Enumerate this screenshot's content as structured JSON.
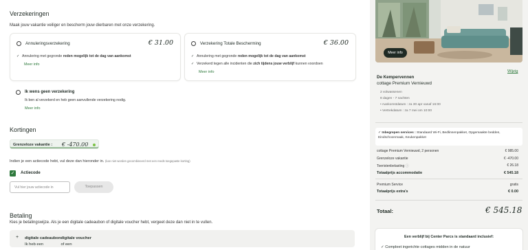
{
  "insurance": {
    "title": "Verzekeringen",
    "subtitle": "Maak jouw vakantie veiliger en bescherm jouw dierbaren met onze verzekering.",
    "options": [
      {
        "name": "Annuleringsverzekering",
        "price": "€ 31.00",
        "feature1_pre": "Annulering met gegronde ",
        "feature1_bold": "reden mogelijk tot de dag van aankomst",
        "more": "Meer info"
      },
      {
        "name": "Verzekering Totale Bescherming",
        "price": "€ 36.00",
        "feature1_pre": "Annulering met gegronde ",
        "feature1_bold": "reden mogelijk tot de dag van aankomst",
        "feature2_pre": "Verzekerd tegen alle incidenten die ",
        "feature2_bold": "zich tijdens jouw verblijf",
        "feature2_post": " kunnen voordoen",
        "more": "Meer info"
      }
    ],
    "none": {
      "name": "Ik wens geen verzekering",
      "desc": "Ik ben al verzekerd en heb geen aanvullende verzekering nodig.",
      "more": "Meer info"
    }
  },
  "discounts": {
    "title": "Kortingen",
    "tag_label": "Grenzeloze vakantie :",
    "tag_value": "€ -470.00",
    "code_info": "Indien je een actiecode hebt, vul deze dan hieronder in.",
    "code_note": "(kan niet worden gecombineerd met een reeds toegepaste korting)",
    "checkbox_label": "Actiecode",
    "input_placeholder": "Vul hier jouw actiecode in",
    "apply_button": "Toepassen"
  },
  "payment": {
    "title": "Betaling",
    "subtitle": "Kies je betalingswijze. Als je een digitale cadeaubon of digitale voucher hebt, vergeet deze dan niet in te vullen.",
    "voucher_pre": "Ik heb een ",
    "voucher_b1": "digitale cadeaubon",
    "voucher_mid": " of een ",
    "voucher_b2": "digitale voucher"
  },
  "summary": {
    "photo_button": "Meer info",
    "park": "De Kempervennen",
    "edit_link": "Wijzig",
    "cottage": "cottage Premium Vernieuwd",
    "guests": "2 volwassenen",
    "duration": "8 dagen - 7 nachten",
    "arrival": "• Aankomstdatum : za 30 apr vanaf 16:00",
    "departure": "• Vertrekdatum : za 7 mei om 10:00",
    "included_label": "Inbegrepen services :",
    "included_text": "Standaard Wi-Fi, Bedlinnenpakket, Opgemaakte bedden, Eindschoonmaak, Keukenpakket",
    "lines": [
      {
        "label": "cottage Premium Vernieuwd, 2 personen",
        "value": "€ 985.00"
      },
      {
        "label": "Grenzeloze vakantie",
        "value": "€ -470.00"
      },
      {
        "label": "Toeristenbelasting",
        "value": "€ 26.18"
      }
    ],
    "total_accommodation_label": "Totaalprijs accommodatie",
    "total_accommodation_value": "€ 545.18",
    "premium_label": "Premium Service",
    "premium_value": "gratis",
    "extras_label": "Totaalprijs extra's",
    "extras_value": "€ 0.00",
    "grand_label": "Totaal:",
    "grand_value": "€ 545.18",
    "standard_title": "Een verblijf bij Center Parcs is standaard inclusief:",
    "standard_item": "Compleet ingerichte cottages midden in de natuur"
  },
  "colors": {
    "accent_green": "#2f7a3d",
    "dark": "#1f2a24",
    "sidebar_bg": "#f3f3f1"
  }
}
